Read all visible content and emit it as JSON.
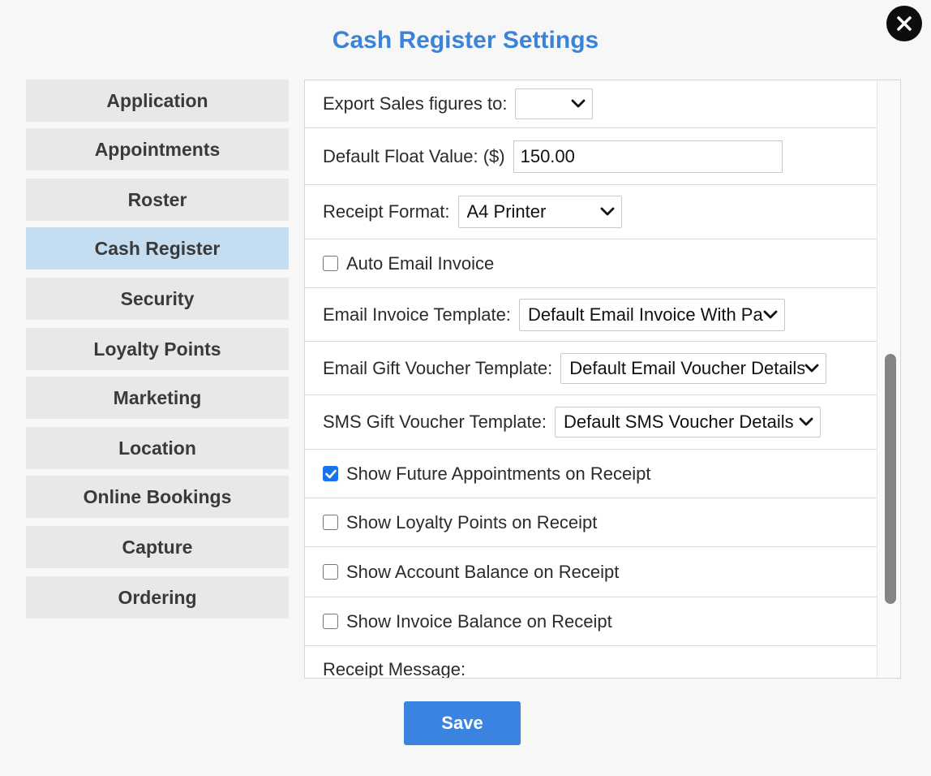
{
  "dialog": {
    "title": "Cash Register Settings",
    "close_icon": "close-icon"
  },
  "sidebar": {
    "active": "Cash Register",
    "items": [
      {
        "label": "Application"
      },
      {
        "label": "Appointments"
      },
      {
        "label": "Roster"
      },
      {
        "label": "Cash Register"
      },
      {
        "label": "Security"
      },
      {
        "label": "Loyalty Points"
      },
      {
        "label": "Marketing"
      },
      {
        "label": "Location"
      },
      {
        "label": "Online Bookings"
      },
      {
        "label": "Capture"
      },
      {
        "label": "Ordering"
      }
    ]
  },
  "settings": {
    "export_sales": {
      "label": "Export Sales figures to:",
      "value": ""
    },
    "default_float": {
      "label": "Default Float Value: ($)",
      "value": "150.00"
    },
    "receipt_format": {
      "label": "Receipt Format:",
      "value": "A4 Printer"
    },
    "auto_email": {
      "label": "Auto Email Invoice",
      "checked": false
    },
    "email_invoice_template": {
      "label": "Email Invoice Template:",
      "value": "Default Email Invoice With Payments"
    },
    "email_gift_voucher_template": {
      "label": "Email Gift Voucher Template:",
      "value": "Default Email Voucher Details"
    },
    "sms_gift_voucher_template": {
      "label": "SMS Gift Voucher Template:",
      "value": "Default SMS Voucher Details"
    },
    "show_future_appointments": {
      "label": "Show Future Appointments on Receipt",
      "checked": true
    },
    "show_loyalty_points": {
      "label": "Show Loyalty Points on Receipt",
      "checked": false
    },
    "show_account_balance": {
      "label": "Show Account Balance on Receipt",
      "checked": false
    },
    "show_invoice_balance": {
      "label": "Show Invoice Balance on Receipt",
      "checked": false
    },
    "receipt_message": {
      "label": "Receipt Message:"
    }
  },
  "footer": {
    "save_label": "Save"
  },
  "colors": {
    "accent": "#3b83d8",
    "active_nav": "#c5ddf0",
    "checkbox_checked": "#1a73e8"
  }
}
